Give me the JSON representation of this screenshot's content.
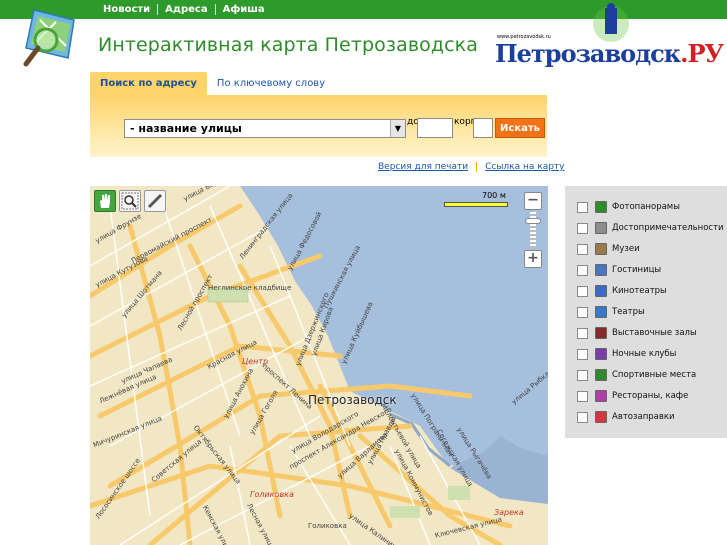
{
  "topnav": {
    "items": [
      "Новости",
      "Адреса",
      "Афиша"
    ]
  },
  "header": {
    "title": "Интерактивная карта Петрозаводска"
  },
  "logo": {
    "url_text": "www.petrozavodsk.ru",
    "name_main": "Петрозаводск",
    "name_dot": ".",
    "name_suffix": "РУ"
  },
  "tabs": [
    {
      "label": "Поиск по адресу",
      "active": true
    },
    {
      "label": "По ключевому слову",
      "active": false
    }
  ],
  "search": {
    "street_value": "- название улицы",
    "house_label": "дом",
    "korpus_label": "корпус",
    "submit_label": "Искать"
  },
  "links": {
    "print": "Версия для печати",
    "map_link": "Ссылка на карту"
  },
  "map": {
    "scale_label": "700 м",
    "city_label": "Петрозаводск",
    "center_label": "Центр",
    "golikovka_label": "Голиковка",
    "golikovka_small": "Голиковка",
    "zareka_label": "Зарека",
    "cemetery_label": "Неглинское кладбище",
    "street_labels": [
      "улица Варкауса",
      "улица Федосовой",
      "Ленинградская улица",
      "улица Фрунзе",
      "Первомайский проспект",
      "улица Кутузова",
      "улица Шотмана",
      "Лесной проспект",
      "Пушкинская улица",
      "улица Кирова",
      "улица Дзержинского",
      "улица Куйбышева",
      "улица Чапаева",
      "Лежнёвая улица",
      "Красная улица",
      "улица Анохина",
      "улица Гоголя",
      "Мичуринская улица",
      "проспект Ленина",
      "улица Володарского",
      "проспект Александра Невского",
      "улица Варламова",
      "улица Правды",
      "Ключевская улица",
      "улица Калинина",
      "Сегежская улица",
      "улица Рыгачёва",
      "улица Пограничная",
      "Лососинское шоссе",
      "Октябрьская улица",
      "Лесная улица",
      "Кемская улица",
      "Советская улица",
      "улица Коммунистов",
      "улица Рыбка",
      "Мелентьевой улица"
    ]
  },
  "layers": [
    {
      "label": "Фотопанорамы",
      "icon": "photo-panorama-icon",
      "color": "#2e8c2a"
    },
    {
      "label": "Достопримечательности",
      "icon": "landmark-icon",
      "color": "#8d8d8d"
    },
    {
      "label": "Музеи",
      "icon": "museum-icon",
      "color": "#9b7a4c"
    },
    {
      "label": "Гостиницы",
      "icon": "hotel-icon",
      "color": "#4a74c0"
    },
    {
      "label": "Кинотеатры",
      "icon": "cinema-icon",
      "color": "#3b6bc5"
    },
    {
      "label": "Театры",
      "icon": "theatre-icon",
      "color": "#3a78c8"
    },
    {
      "label": "Выставочные залы",
      "icon": "exhibition-icon",
      "color": "#8a2b2b"
    },
    {
      "label": "Ночные клубы",
      "icon": "nightclub-icon",
      "color": "#7a3fa6"
    },
    {
      "label": "Спортивные места",
      "icon": "sport-icon",
      "color": "#2f8a2f"
    },
    {
      "label": "Рестораны, кафе",
      "icon": "restaurant-icon",
      "color": "#b23fa6"
    },
    {
      "label": "Автозаправки",
      "icon": "gas-station-icon",
      "color": "#d13a3a"
    }
  ],
  "colors": {
    "topbar": "#2f9a2c",
    "tab_active": "#fed36a",
    "search_button": "#f37216",
    "water": "#a5bfdd",
    "land": "#f2e7c4",
    "road": "#f7c96a"
  }
}
